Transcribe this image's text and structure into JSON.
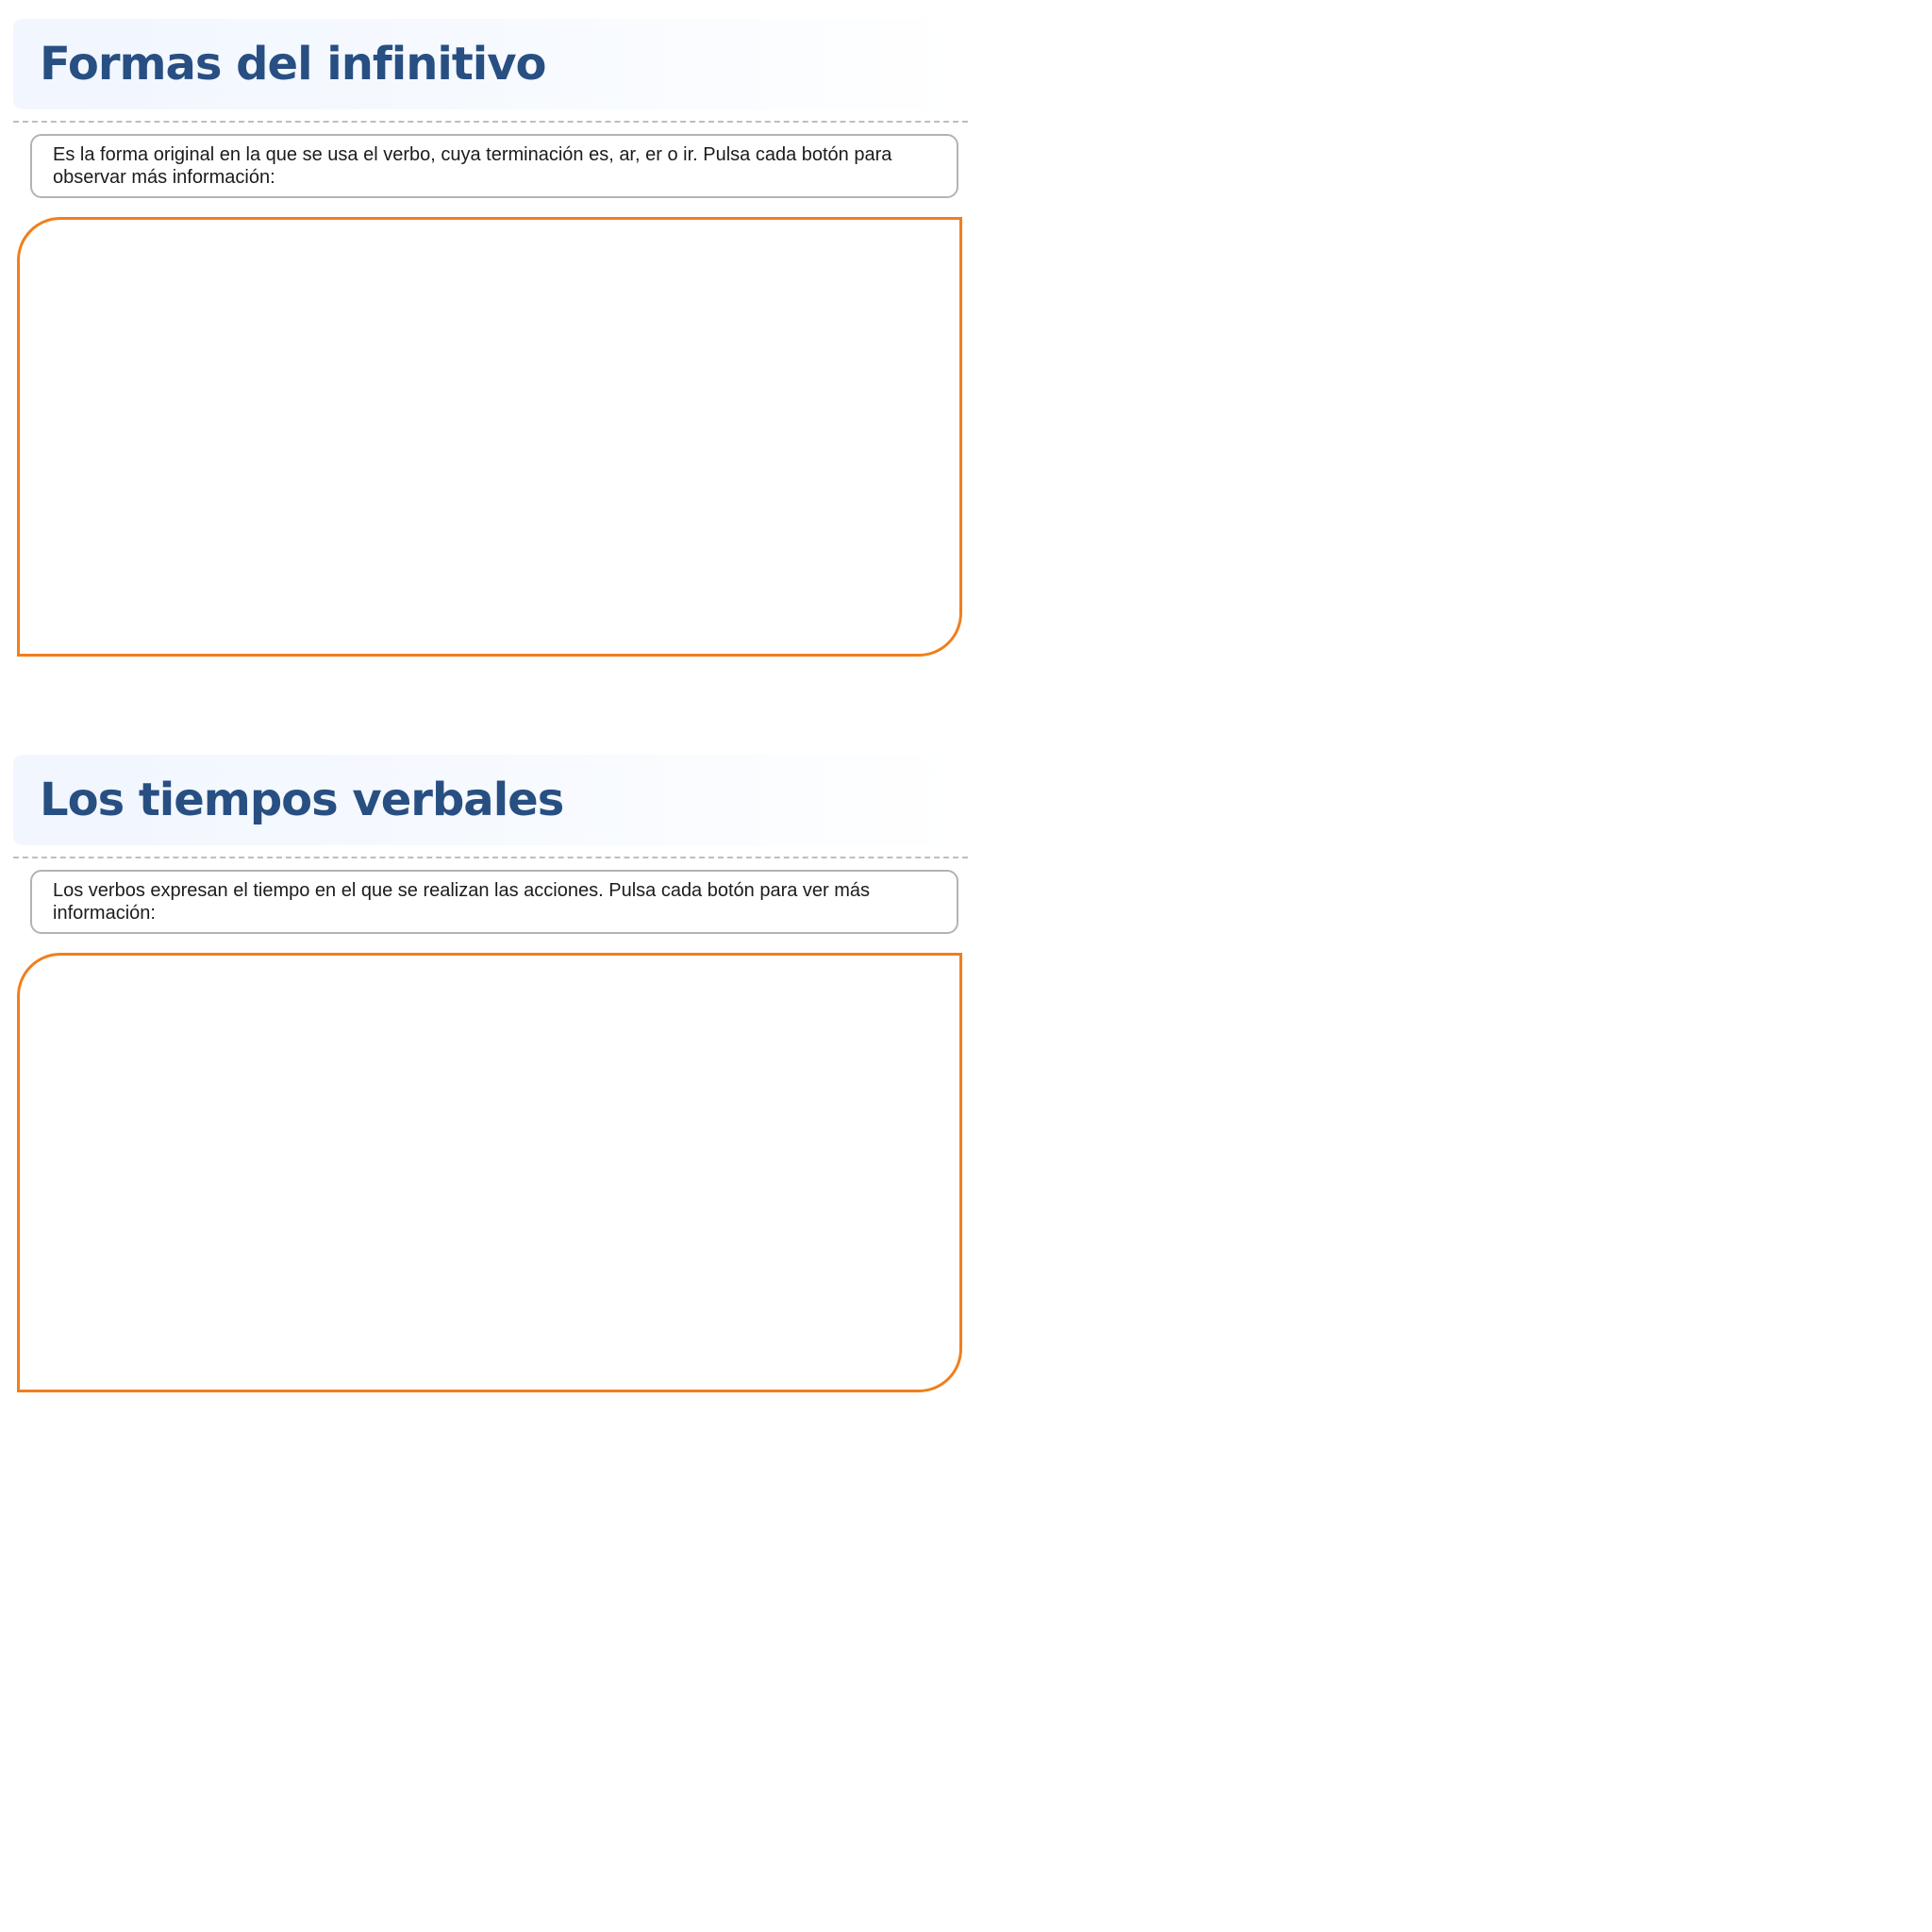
{
  "sections": [
    {
      "title": "Formas del infinitivo",
      "description": "Es la forma original en la que se usa el verbo, cuya terminación es, ar, er o ir. Pulsa cada botón para observar más información:"
    },
    {
      "title": "Los tiempos verbales",
      "description": "Los verbos expresan el tiempo en el que se realizan las acciones. Pulsa cada botón para ver más información:"
    }
  ],
  "colors": {
    "title": "#284f82",
    "frame_border": "#f07f1b",
    "description_border": "#b3b3b3",
    "divider": "#b9bfc9"
  }
}
